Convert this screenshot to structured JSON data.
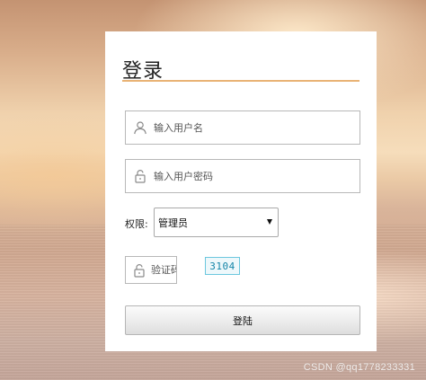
{
  "login": {
    "title": "登录",
    "username": {
      "placeholder": "输入用户名",
      "icon": "user-icon"
    },
    "password": {
      "placeholder": "输入用户密码",
      "icon": "lock-icon"
    },
    "role": {
      "label": "权限:",
      "selected": "管理员"
    },
    "captcha": {
      "placeholder": "验证码",
      "icon": "lock-icon",
      "code": "3104"
    },
    "submit_label": "登陆"
  },
  "watermark": "CSDN @qq1778233331",
  "colors": {
    "title_rule": "#e9b376",
    "captcha_border": "#6cc7de",
    "captcha_text": "#1585a8"
  }
}
